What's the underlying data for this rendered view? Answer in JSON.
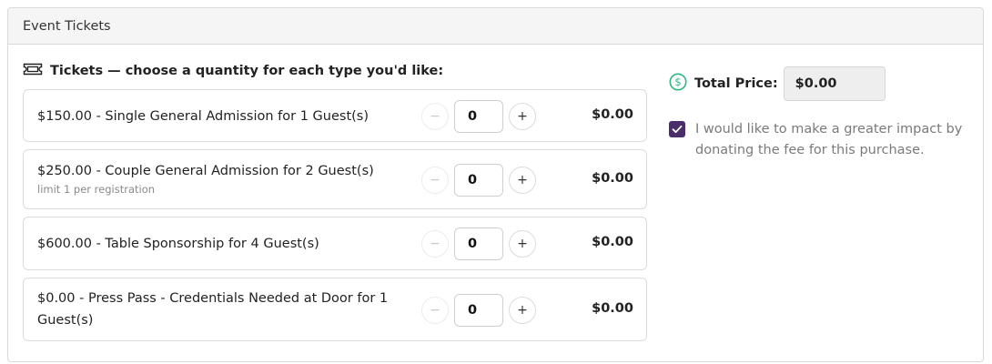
{
  "card": {
    "header_title": "Event Tickets"
  },
  "tickets_section": {
    "title": "Tickets — choose a quantity for each type you'd like:",
    "icon": "ticket-icon"
  },
  "tickets": [
    {
      "name": "$150.00 - Single General Admission for 1 Guest(s)",
      "limit": "",
      "quantity": "0",
      "line_total": "$0.00"
    },
    {
      "name": "$250.00 - Couple General Admission for 2 Guest(s)",
      "limit": "limit 1 per registration",
      "quantity": "0",
      "line_total": "$0.00"
    },
    {
      "name": "$600.00 - Table Sponsorship for 4 Guest(s)",
      "limit": "",
      "quantity": "0",
      "line_total": "$0.00"
    },
    {
      "name": "$0.00 - Press Pass - Credentials Needed at Door for 1 Guest(s)",
      "limit": "",
      "quantity": "0",
      "line_total": "$0.00"
    }
  ],
  "stepper": {
    "decrement": "−",
    "increment": "+"
  },
  "total": {
    "label": "Total Price:",
    "value": "$0.00",
    "icon": "dollar-circle-icon"
  },
  "donation": {
    "checked": true,
    "text": "I would like to make a greater impact by donating the fee for this purchase."
  },
  "colors": {
    "accent": "#4b2d6b",
    "success_green": "#2fb77f",
    "border": "#dcdcdc",
    "header_bg": "#f5f5f5"
  }
}
